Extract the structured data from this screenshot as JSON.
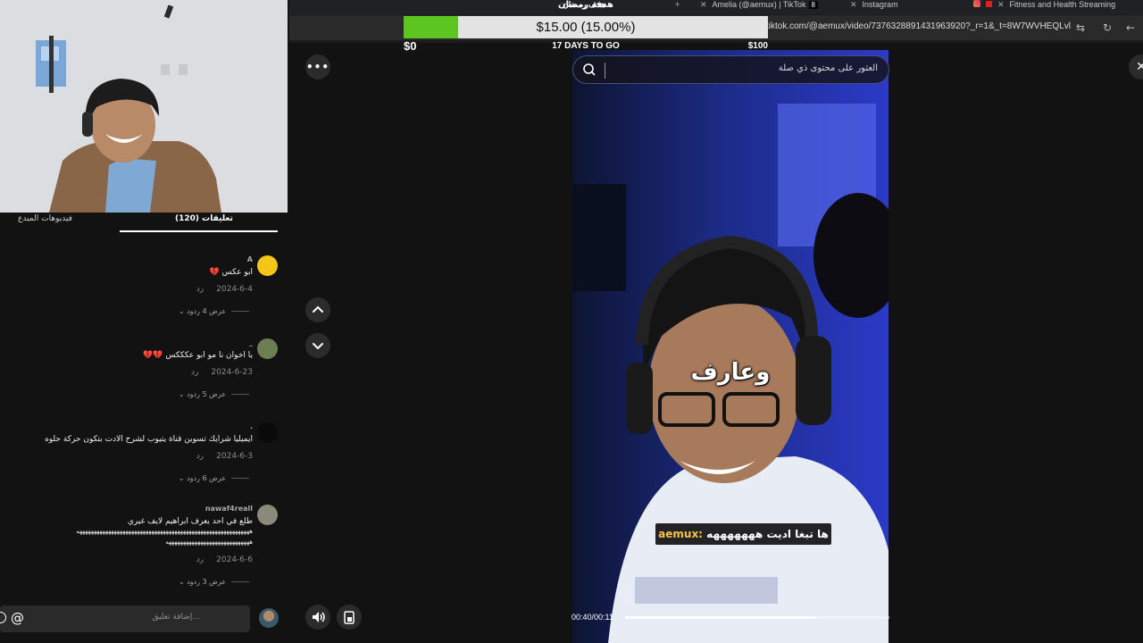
{
  "browser": {
    "active_tab": "هدف رمضان",
    "tabs": [
      {
        "label": "Amelia (@aemux) | TikTok",
        "badge": "8"
      },
      {
        "label": "Instagram"
      },
      {
        "label": "Fitness and Health Streaming"
      }
    ],
    "url": "tiktok.com/@aemux/video/7376328891431963920?_r=1&_t=8W7WVHEQLvl"
  },
  "goal": {
    "title": "",
    "amount_text": "$15.00 (15.00%)",
    "progress_fraction": 0.15,
    "min_label": "$0",
    "days_text": "17 DAYS TO GO",
    "max_label": "$100",
    "fill_color": "#5cc520"
  },
  "panel": {
    "tab_comments": "(120) تعليقات",
    "tab_videos": "فيديوهات المبدع"
  },
  "comments": [
    {
      "user": "A",
      "text": "ابو عكس",
      "heart": "💔",
      "date": "2024-6-4",
      "reply": "رد",
      "replies": "عرض 4 ردود",
      "avatar_color": "#f5c518"
    },
    {
      "user": "_",
      "text": "يا اخوان نا مو ابو عكككس",
      "heart": "💔💔",
      "date": "2024-6-23",
      "reply": "رد",
      "replies": "عرض 5 ردود",
      "avatar_color": "#6b7f52"
    },
    {
      "user": ".",
      "text": "ايميليا شرايك تسوين قناة يتيوب لشرح الادت بتكون حركة حلوه",
      "heart": "",
      "date": "2024-6-3",
      "reply": "رد",
      "replies": "عرض 6 ردود",
      "avatar_color": "#0a0a0a"
    },
    {
      "user": "nawaf4reall",
      "text": "طلع في احد يعرف ابراهيم لايف غيري",
      "text2": "ههههههههههههههههههههههههههههههههههههههههههههههههههههههههههههه",
      "text3": "هههههههههههههههههههههههههههههه",
      "heart": "",
      "date": "2024-6-6",
      "reply": "رد",
      "replies": "عرض 3 ردود",
      "avatar_color": "#8a8a7a"
    }
  ],
  "composer": {
    "placeholder": "إضافة تعليق...",
    "at_symbol": "@"
  },
  "search": {
    "placeholder": "العثور على محتوى ذي صلة"
  },
  "video": {
    "caption_big": "وعارف",
    "caption_username": "aemux:",
    "caption_text": "ها تبغا اديت هههههههه",
    "time": "00:40/00:11",
    "progress_fraction": 0.72
  },
  "icons": {
    "more": "more-horizontal-icon",
    "up": "chevron-up-icon",
    "down": "chevron-down-icon",
    "volume": "volume-icon",
    "pip": "picture-in-picture-icon",
    "close": "close-icon"
  }
}
